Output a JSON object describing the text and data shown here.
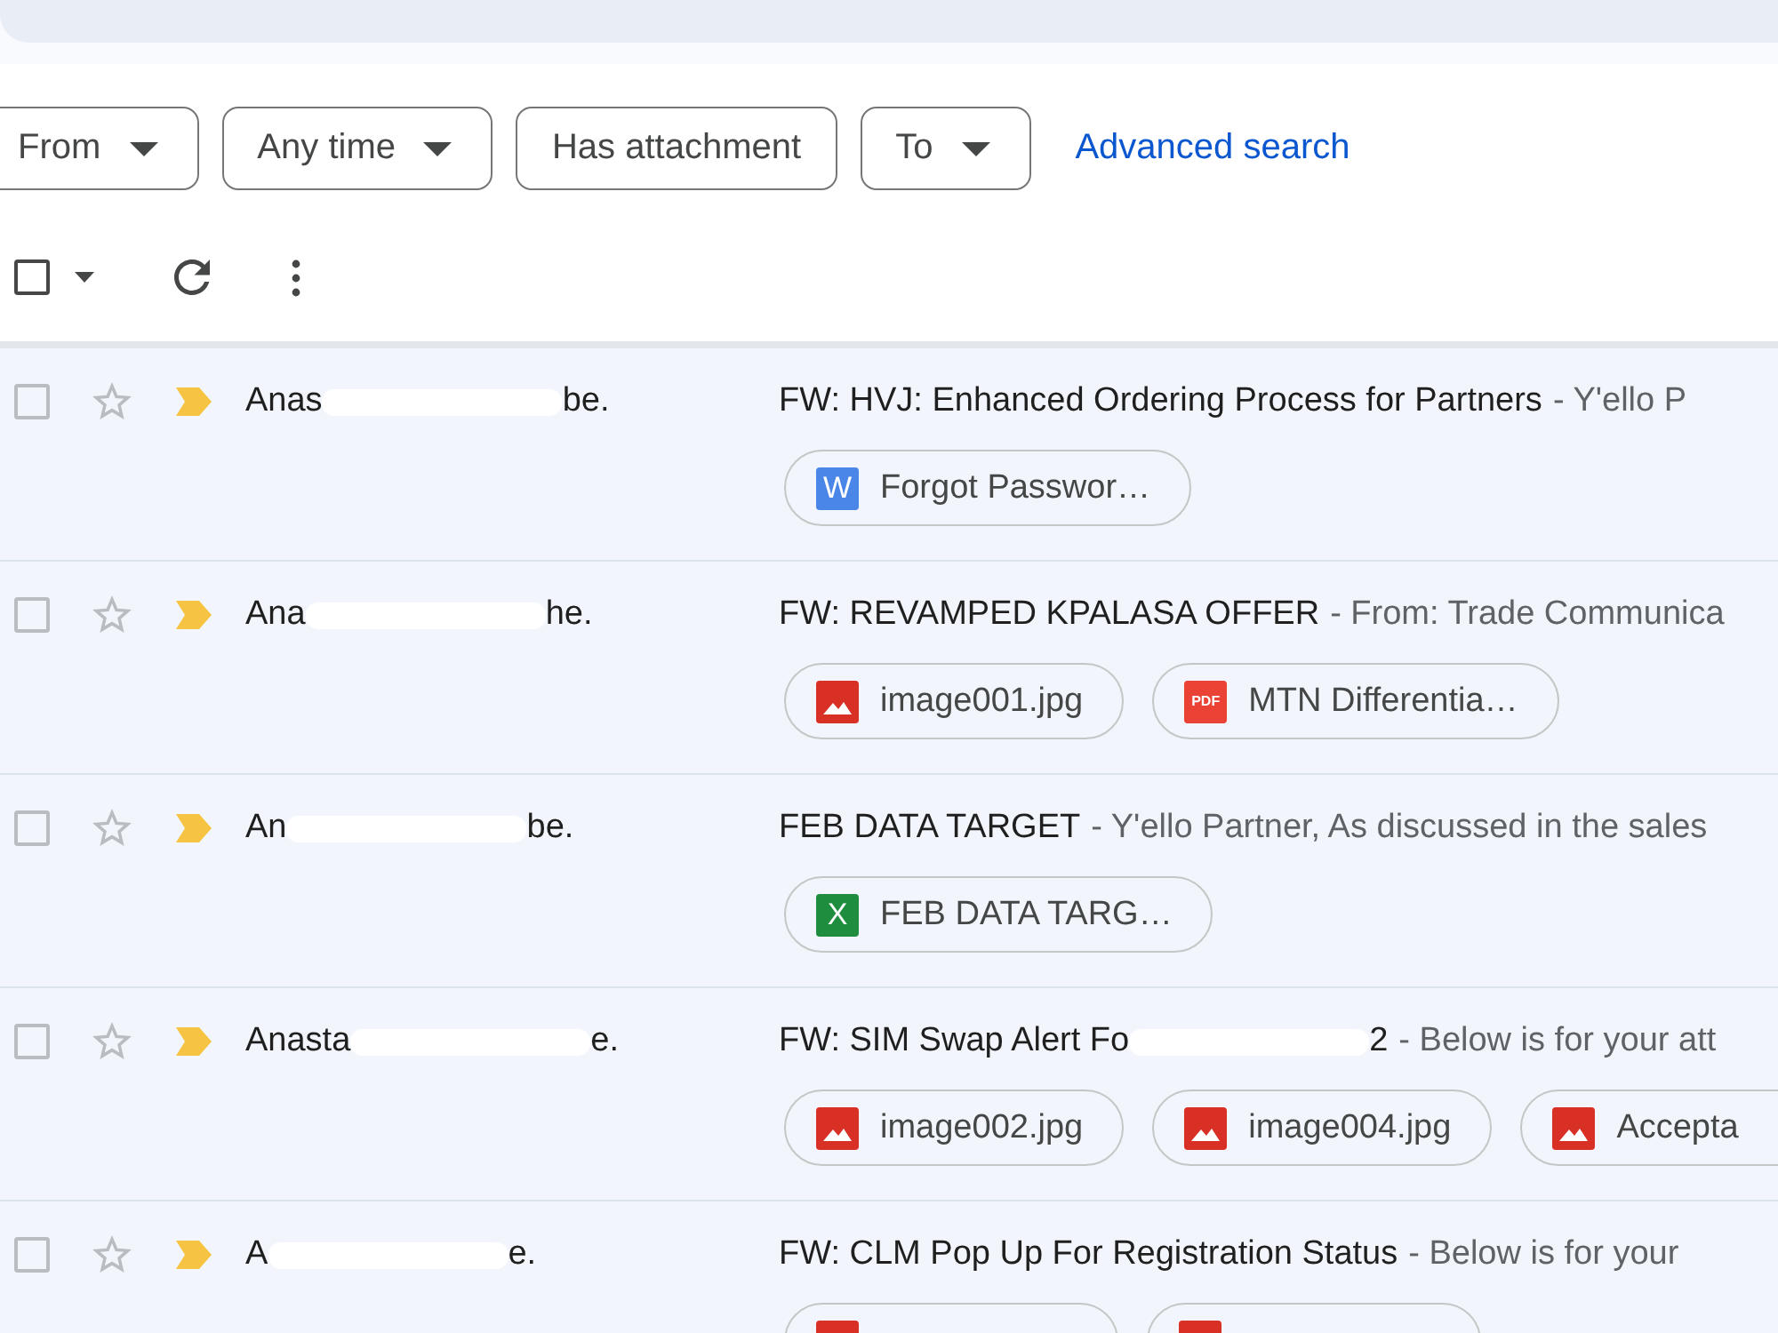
{
  "filters": [
    {
      "label": "From",
      "dropdown": true
    },
    {
      "label": "Any time",
      "dropdown": true
    },
    {
      "label": "Has attachment",
      "dropdown": false
    },
    {
      "label": "To",
      "dropdown": true
    }
  ],
  "advanced_search": "Advanced search",
  "toolbar": {
    "select_all_checked": false
  },
  "emails": [
    {
      "selected": false,
      "starred": false,
      "important": true,
      "sender": [
        "Anas",
        "be."
      ],
      "subject": [
        "FW: HVJ: Enhanced Ordering Process for Partners"
      ],
      "snippet": "- Y'ello P",
      "attachments": [
        {
          "kind": "word",
          "badge": "W",
          "name": "Forgot Passwor…"
        }
      ]
    },
    {
      "selected": false,
      "starred": false,
      "important": true,
      "sender": [
        "Ana",
        "he."
      ],
      "subject": [
        "FW: REVAMPED KPALASA OFFER"
      ],
      "snippet": "- From: Trade Communica",
      "attachments": [
        {
          "kind": "image",
          "name": "image001.jpg"
        },
        {
          "kind": "pdf",
          "badge": "PDF",
          "name": "MTN Differentia…"
        }
      ]
    },
    {
      "selected": false,
      "starred": false,
      "important": true,
      "sender": [
        "An",
        "be."
      ],
      "subject": [
        "FEB DATA TARGET"
      ],
      "snippet": "- Y'ello Partner, As discussed in the sales",
      "attachments": [
        {
          "kind": "excel",
          "badge": "X",
          "name": "FEB DATA TARG…"
        }
      ]
    },
    {
      "selected": false,
      "starred": false,
      "important": true,
      "sender": [
        "Anasta",
        "e."
      ],
      "subject": [
        "FW: SIM Swap Alert Fo",
        "2"
      ],
      "snippet": "- Below is for your att",
      "attachments": [
        {
          "kind": "image",
          "name": "image002.jpg"
        },
        {
          "kind": "image",
          "name": "image004.jpg"
        },
        {
          "kind": "image",
          "name": "Accepta"
        }
      ]
    },
    {
      "selected": false,
      "starred": false,
      "important": true,
      "sender": [
        "A",
        "e."
      ],
      "subject": [
        "FW: CLM Pop Up For Registration Status"
      ],
      "snippet": "- Below is for your",
      "attachments": [
        {
          "kind": "image"
        },
        {
          "kind": "image"
        }
      ]
    }
  ]
}
